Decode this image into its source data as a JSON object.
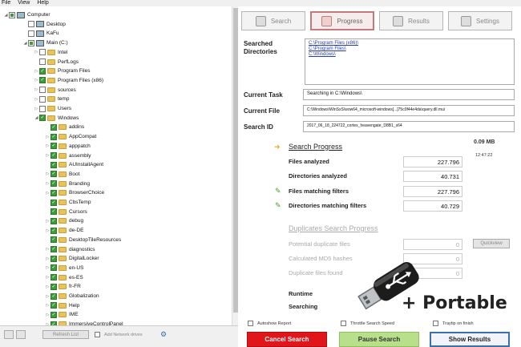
{
  "menu": [
    "File",
    "View",
    "Help"
  ],
  "tree": [
    {
      "label": "Computer",
      "indent": 0,
      "arrow": "◢",
      "check": "part",
      "icon": "pc"
    },
    {
      "label": "Desktop",
      "indent": 1,
      "arrow": "",
      "check": "off",
      "icon": "desk"
    },
    {
      "label": "KaFu",
      "indent": 1,
      "arrow": "",
      "check": "off",
      "icon": "user"
    },
    {
      "label": "Main (C:)",
      "indent": 1,
      "arrow": "◢",
      "check": "part",
      "icon": "drive"
    },
    {
      "label": "Intel",
      "indent": 2,
      "arrow": "▷",
      "check": "off",
      "icon": "folder"
    },
    {
      "label": "PerfLogs",
      "indent": 2,
      "arrow": "",
      "check": "off",
      "icon": "folder"
    },
    {
      "label": "Program Files",
      "indent": 2,
      "arrow": "▷",
      "check": "on",
      "icon": "folder"
    },
    {
      "label": "Program Files (x86)",
      "indent": 2,
      "arrow": "▷",
      "check": "on",
      "icon": "folder"
    },
    {
      "label": "sources",
      "indent": 2,
      "arrow": "▷",
      "check": "off",
      "icon": "folder"
    },
    {
      "label": "temp",
      "indent": 2,
      "arrow": "▷",
      "check": "off",
      "icon": "folder"
    },
    {
      "label": "Users",
      "indent": 2,
      "arrow": "▷",
      "check": "off",
      "icon": "folder"
    },
    {
      "label": "Windows",
      "indent": 2,
      "arrow": "◢",
      "check": "on",
      "icon": "folder"
    },
    {
      "label": "addins",
      "indent": 3,
      "arrow": "",
      "check": "on",
      "icon": "folder"
    },
    {
      "label": "AppCompat",
      "indent": 3,
      "arrow": "▷",
      "check": "on",
      "icon": "folder"
    },
    {
      "label": "apppatch",
      "indent": 3,
      "arrow": "▷",
      "check": "on",
      "icon": "folder"
    },
    {
      "label": "assembly",
      "indent": 3,
      "arrow": "▷",
      "check": "on",
      "icon": "folder"
    },
    {
      "label": "AUInstallAgent",
      "indent": 3,
      "arrow": "",
      "check": "on",
      "icon": "folder"
    },
    {
      "label": "Boot",
      "indent": 3,
      "arrow": "▷",
      "check": "on",
      "icon": "folder"
    },
    {
      "label": "Branding",
      "indent": 3,
      "arrow": "▷",
      "check": "on",
      "icon": "folder"
    },
    {
      "label": "BrowserChoice",
      "indent": 3,
      "arrow": "▷",
      "check": "on",
      "icon": "folder"
    },
    {
      "label": "CbsTemp",
      "indent": 3,
      "arrow": "",
      "check": "on",
      "icon": "folder"
    },
    {
      "label": "Cursors",
      "indent": 3,
      "arrow": "",
      "check": "on",
      "icon": "folder"
    },
    {
      "label": "debug",
      "indent": 3,
      "arrow": "▷",
      "check": "on",
      "icon": "folder"
    },
    {
      "label": "de-DE",
      "indent": 3,
      "arrow": "▷",
      "check": "on",
      "icon": "folder"
    },
    {
      "label": "DesktopTileResources",
      "indent": 3,
      "arrow": "",
      "check": "on",
      "icon": "folder"
    },
    {
      "label": "diagnostics",
      "indent": 3,
      "arrow": "▷",
      "check": "on",
      "icon": "folder"
    },
    {
      "label": "DigitalLocker",
      "indent": 3,
      "arrow": "▷",
      "check": "on",
      "icon": "folder"
    },
    {
      "label": "en-US",
      "indent": 3,
      "arrow": "▷",
      "check": "on",
      "icon": "folder"
    },
    {
      "label": "es-ES",
      "indent": 3,
      "arrow": "▷",
      "check": "on",
      "icon": "folder"
    },
    {
      "label": "fr-FR",
      "indent": 3,
      "arrow": "▷",
      "check": "on",
      "icon": "folder"
    },
    {
      "label": "Globalization",
      "indent": 3,
      "arrow": "▷",
      "check": "on",
      "icon": "folder"
    },
    {
      "label": "Help",
      "indent": 3,
      "arrow": "▷",
      "check": "on",
      "icon": "folder"
    },
    {
      "label": "IME",
      "indent": 3,
      "arrow": "▷",
      "check": "on",
      "icon": "folder"
    },
    {
      "label": "ImmersiveControlPanel",
      "indent": 3,
      "arrow": "▷",
      "check": "on",
      "icon": "folder"
    }
  ],
  "bottom": {
    "refresh": "Refresh List",
    "add_network": "Add Network drives"
  },
  "tabs": [
    {
      "label": "Search",
      "icon": "search-icon",
      "active": false
    },
    {
      "label": "Progress",
      "icon": "progress-icon",
      "active": true
    },
    {
      "label": "Results",
      "icon": "results-icon",
      "active": false
    },
    {
      "label": "Settings",
      "icon": "settings-icon",
      "active": false
    }
  ],
  "labels": {
    "searched_dirs_1": "Searched",
    "searched_dirs_2": "Directories",
    "current_task": "Current Task",
    "current_file": "Current File",
    "search_id": "Search ID"
  },
  "searched_dirs": [
    "C:\\Program Files (x86)\\",
    "C:\\Program Files\\",
    "C:\\Windows\\"
  ],
  "current_task": "Searching in C:\\Windows\\",
  "current_file": "C:\\Windows\\WinSxS\\wow64_microsoft-windows[...]75c0f44e4da\\query.dll.mui",
  "search_id": "2017_06_18_224722_cortex_heavengate_D8B1_x64",
  "size": "0.09 MB",
  "time": "12:47:22",
  "progress": {
    "title": "Search Progress",
    "rows": [
      {
        "label": "Files analyzed",
        "value": "227.796",
        "icon": false
      },
      {
        "label": "Directories analyzed",
        "value": "40.731",
        "icon": false
      },
      {
        "label": "Files matching filters",
        "value": "227.796",
        "icon": true
      },
      {
        "label": "Directories matching filters",
        "value": "40.729",
        "icon": true
      }
    ]
  },
  "duplicates": {
    "title": "Duplicates Search Progress",
    "rows": [
      {
        "label": "Potential duplicate files",
        "value": "0"
      },
      {
        "label": "Calculated MD5 hashes",
        "value": "0"
      },
      {
        "label": "Duplicate files found",
        "value": "0"
      }
    ],
    "quickview": "Quickview"
  },
  "runtime_label": "Runtime",
  "searching_label": "Searching",
  "options": {
    "autoshow": "Autoshow Report",
    "throttle": "Throttle Search Speed",
    "traytip": "Traytip on finish"
  },
  "buttons": {
    "cancel": "Cancel Search",
    "pause": "Pause Search",
    "show": "Show Results"
  },
  "portable_text": "+ Portable",
  "colors": {
    "check_green": "#3a9d3a",
    "cancel_red": "#e0161b",
    "pause_green": "#b8e08a",
    "active_tab": "#c47a7a"
  }
}
